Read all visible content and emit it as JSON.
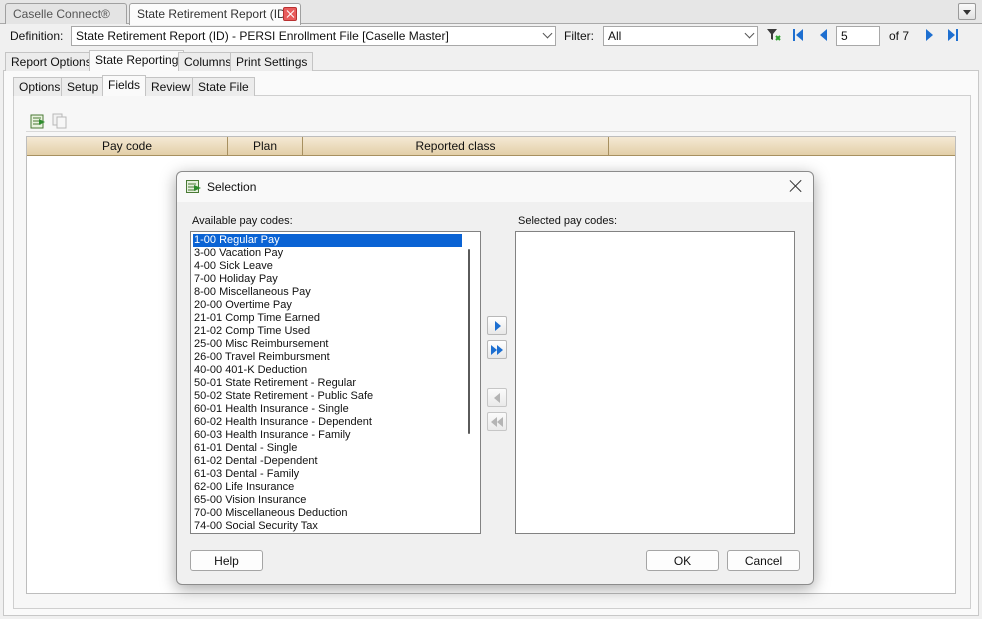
{
  "window_tabs": [
    {
      "label": "Caselle Connect®"
    },
    {
      "label": "State Retirement Report (ID)"
    }
  ],
  "definition": {
    "label": "Definition:",
    "value": "State Retirement Report (ID) - PERSI Enrollment File [Caselle Master]"
  },
  "filter": {
    "label": "Filter:",
    "value": "All"
  },
  "pager": {
    "current": "5",
    "total_text": "of 7"
  },
  "main_tabs": [
    "Report Options",
    "State Reporting",
    "Columns",
    "Print Settings"
  ],
  "sub_tabs": [
    "Options",
    "Setup",
    "Fields",
    "Review",
    "State File"
  ],
  "grid": {
    "columns": [
      "Pay code",
      "Plan",
      "Reported class",
      ""
    ]
  },
  "dialog": {
    "title": "Selection",
    "available_label": "Available pay codes:",
    "selected_label": "Selected pay codes:",
    "available_items": [
      "1-00 Regular Pay",
      "3-00 Vacation Pay",
      "4-00 Sick Leave",
      "7-00 Holiday Pay",
      "8-00 Miscellaneous Pay",
      "20-00 Overtime Pay",
      "21-01 Comp Time Earned",
      "21-02 Comp Time Used",
      "25-00 Misc Reimbursement",
      "26-00 Travel Reimbursment",
      "40-00 401-K Deduction",
      "50-01 State Retirement - Regular",
      "50-02 State Retirement - Public Safe",
      "60-01 Health Insurance - Single",
      "60-02 Health Insurance - Dependent",
      "60-03 Health Insurance - Family",
      "61-01 Dental - Single",
      "61-02 Dental -Dependent",
      "61-03 Dental - Family",
      "62-00 Life Insurance",
      "65-00 Vision Insurance",
      "70-00 Miscellaneous Deduction",
      "74-00 Social Security Tax"
    ],
    "selected_items": [],
    "help_label": "Help",
    "ok_label": "OK",
    "cancel_label": "Cancel"
  },
  "colors": {
    "selection": "#0a63d4",
    "arrow_blue": "#1e6fd0",
    "grid_header": "#e8d7b3",
    "close_red": "#e85c5c"
  }
}
